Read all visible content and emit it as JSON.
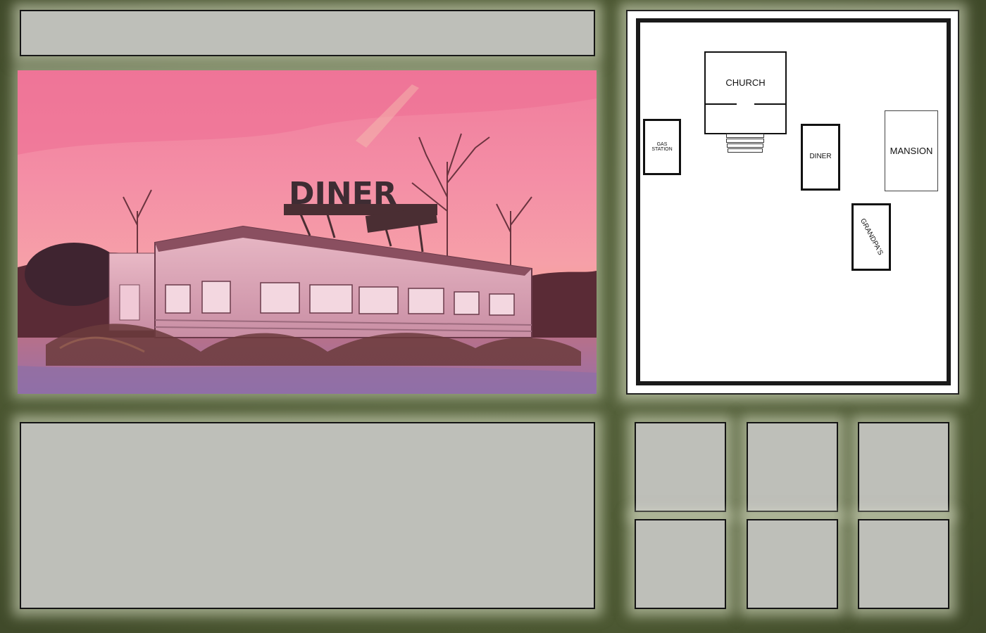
{
  "colors": {
    "frame": "#4e5b34",
    "panel": "#bebfb9",
    "panel_border": "#141414",
    "map_background": "#ffffff"
  },
  "scene": {
    "sign_text": "DINER"
  },
  "map": {
    "buildings": {
      "church": "CHURCH",
      "gas_station": "GAS\nSTATION",
      "diner": "DINER",
      "mansion": "MANSION",
      "grandpas": "GRANDPA'S"
    }
  },
  "inventory": {
    "slot_count": 6
  }
}
